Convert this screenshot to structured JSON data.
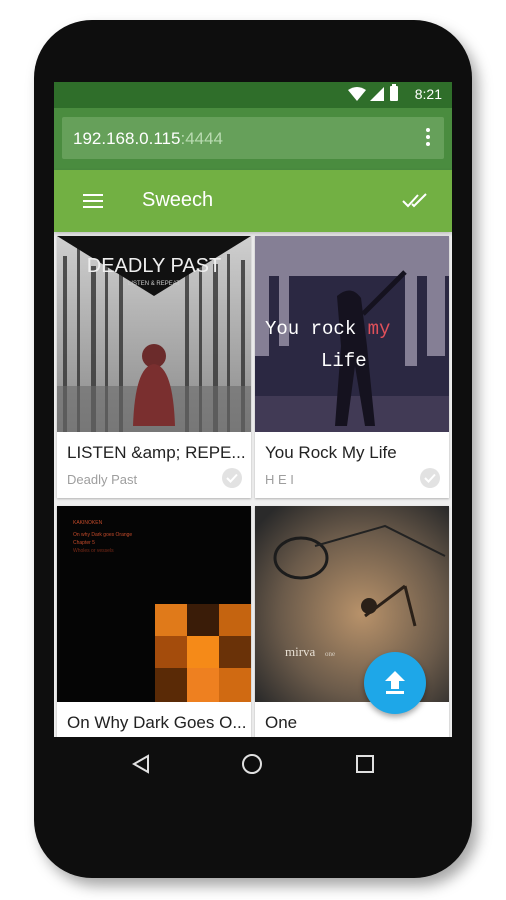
{
  "status": {
    "time": "8:21"
  },
  "urlbar": {
    "host": "192.168.0.115",
    "port": ":4444"
  },
  "appbar": {
    "title": "Sweech"
  },
  "cards": [
    {
      "title": "LISTEN &amp; REPE...",
      "artist": "Deadly Past",
      "art_text_main": "DEADLY PAST",
      "art_text_sub": "LISTEN & REPEAT"
    },
    {
      "title": "You Rock My Life",
      "artist": "H E I",
      "art_text_main": "You rock my",
      "art_text_sub": "Life"
    },
    {
      "title": "On Why Dark Goes O...",
      "artist": "",
      "art_text_lines": [
        "KAKINOKEN",
        "On why Dark goes Orange",
        "Chapter 5",
        "Wholes or vessels"
      ]
    },
    {
      "title": "One",
      "artist": "",
      "art_text_main": "mirva",
      "art_text_sub": "one"
    }
  ],
  "colors": {
    "statusbar": "#2f6e2a",
    "urlbar": "#4a8c3f",
    "appbar": "#72b043",
    "fab": "#1ea7e8"
  },
  "icons": {
    "wifi": "wifi-icon",
    "signal": "signal-icon",
    "battery": "battery-icon",
    "menu": "overflow-menu-icon",
    "drawer": "hamburger-icon",
    "select_all": "done-all-icon",
    "upload": "upload-icon",
    "back": "back-icon",
    "home": "home-icon",
    "recents": "recents-icon"
  }
}
